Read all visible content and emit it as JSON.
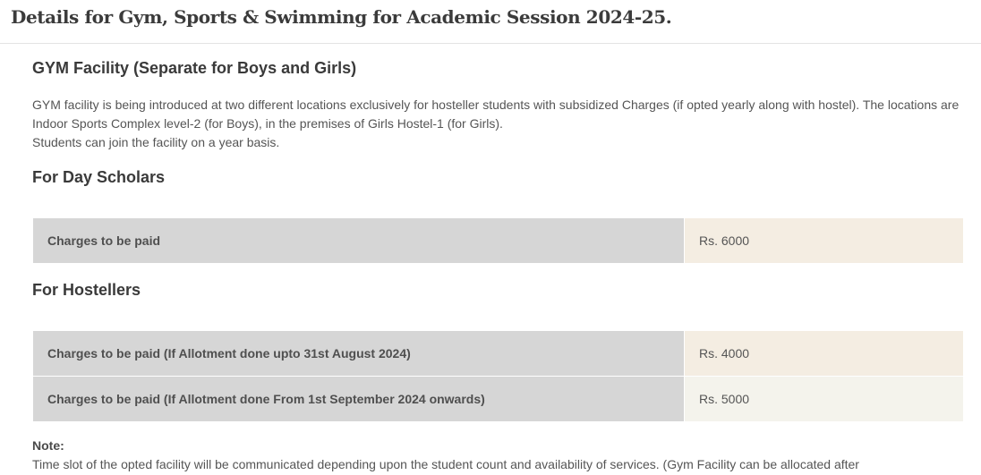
{
  "page_title": "Details for Gym, Sports & Swimming for Academic Session 2024-25.",
  "gym": {
    "title": "GYM Facility (Separate for Boys and Girls)",
    "description_1": "GYM facility is being introduced at two different locations exclusively for hosteller students with subsidized Charges (if opted yearly along with hostel). The locations are Indoor Sports Complex level-2 (for Boys), in the premises of Girls Hostel-1 (for Girls).",
    "description_2": "Students can join the facility on a year basis."
  },
  "day_scholars": {
    "title": "For Day Scholars",
    "rows": [
      {
        "label": "Charges to be paid",
        "value": "Rs. 6000"
      }
    ]
  },
  "hostellers": {
    "title": "For Hostellers",
    "rows": [
      {
        "label": "Charges to be paid (If Allotment done upto 31st August 2024)",
        "value": "Rs. 4000"
      },
      {
        "label": "Charges to be paid (If Allotment done From 1st September 2024 onwards)",
        "value": "Rs. 5000"
      }
    ]
  },
  "note": {
    "heading": "Note:",
    "text": "Time slot of the opted facility will be communicated depending upon the student count and availability of services. (Gym Facility can be allocated after"
  }
}
